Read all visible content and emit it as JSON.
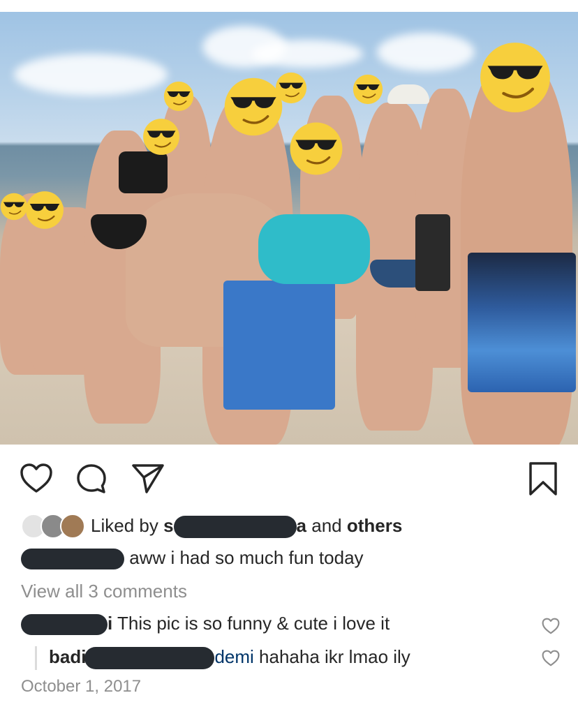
{
  "post": {
    "photo_alt": "beach group photo",
    "liked_prefix": "Liked by ",
    "liked_user_start": "s",
    "liked_user_end": "a",
    "liked_and": " and ",
    "liked_others": "others",
    "caption_text": "aww i had so much fun today",
    "view_all": "View all 3 comments",
    "comments": [
      {
        "user_end": "i",
        "text": "This pic is so funny & cute i love it"
      },
      {
        "user_start": "badi",
        "mention": "demi",
        "text": " hahaha ikr lmao ily"
      }
    ],
    "date": "October 1, 2017"
  },
  "icons": {
    "like": "heart-outline-icon",
    "comment": "comment-bubble-icon",
    "share": "paper-plane-icon",
    "save": "bookmark-icon",
    "comment_like": "heart-outline-small-icon"
  },
  "colors": {
    "text": "#262626",
    "muted": "#8e8e8e",
    "mention": "#003569",
    "redaction": "#262b31"
  }
}
